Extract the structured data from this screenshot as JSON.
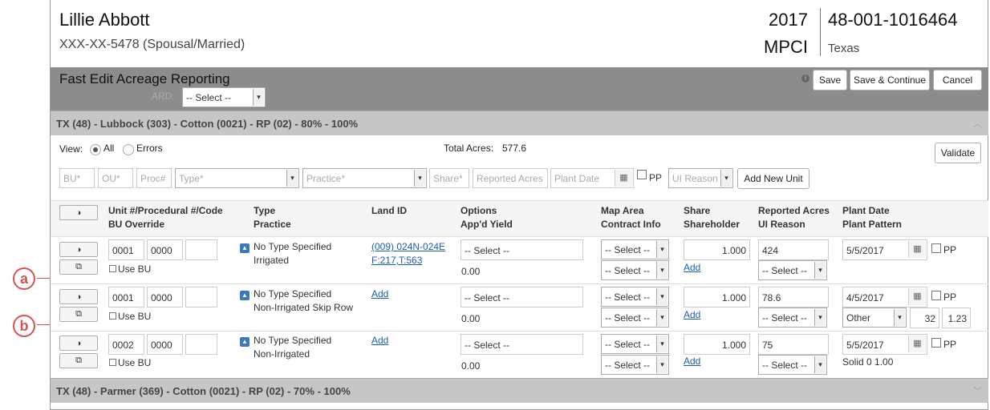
{
  "header": {
    "name": "Lillie Abbott",
    "ssn": "XXX-XX-5478 (Spousal/Married)",
    "year": "2017",
    "insurance": "MPCI",
    "policy": "48-001-1016464",
    "state": "Texas"
  },
  "toolbar": {
    "title": "Fast Edit Acreage Reporting",
    "ard_label": "ARD:",
    "ard_value": "-- Select --",
    "save": "Save",
    "save_continue": "Save & Continue",
    "cancel": "Cancel"
  },
  "section1": {
    "title": "TX (48) - Lubbock (303) - Cotton (0021) - RP (02) - 80% - 100%"
  },
  "section2": {
    "title": "TX (48) - Parmer (369) - Cotton (0021) - RP (02) - 70% - 100%"
  },
  "view": {
    "label": "View:",
    "all": "All",
    "errors": "Errors",
    "total_label": "Total Acres:",
    "total_value": "577.6",
    "validate": "Validate"
  },
  "add_form": {
    "bu": "BU*",
    "ou": "OU*",
    "proc": "Proc#",
    "type": "Type*",
    "practice": "Practice*",
    "share": "Share*",
    "reported_acres": "Reported Acres",
    "plant_date": "Plant Date",
    "pp": "PP",
    "ui_reason": "UI Reason",
    "add_new_unit": "Add New Unit"
  },
  "columns": {
    "unit_1": "Unit #/Procedural #/Code",
    "unit_2": "BU Override",
    "type_1": "Type",
    "type_2": "Practice",
    "land": "Land ID",
    "options_1": "Options",
    "options_2": "App'd Yield",
    "map_1": "Map Area",
    "map_2": "Contract Info",
    "share_1": "Share",
    "share_2": "Shareholder",
    "acres_1": "Reported Acres",
    "acres_2": "UI Reason",
    "plant_1": "Plant Date",
    "plant_2": "Plant Pattern"
  },
  "rows": [
    {
      "unit": "0001",
      "proc": "0000",
      "code": "",
      "use_bu": "Use BU",
      "type": "No Type Specified",
      "practice": "Irrigated",
      "land_1": "(009) 024N-024E",
      "land_2": "F:217,T:563",
      "options": "-- Select --",
      "yield": "0.00",
      "map": "-- Select --",
      "contract": "-- Select --",
      "share": "1.000",
      "share_add": "Add",
      "acres": "424",
      "ui_reason": "-- Select --",
      "plant_date": "5/5/2017",
      "pp": "PP"
    },
    {
      "unit": "0001",
      "proc": "0000",
      "code": "",
      "use_bu": "Use BU",
      "type": "No Type Specified",
      "practice": "Non-Irrigated Skip Row",
      "land_add": "Add",
      "options": "-- Select --",
      "yield": "0.00",
      "map": "-- Select --",
      "contract": "-- Select --",
      "share": "1.000",
      "share_add": "Add",
      "acres": "78.6",
      "ui_reason": "-- Select --",
      "plant_date": "4/5/2017",
      "pp": "PP",
      "pattern": "Other",
      "pattern_a": "32",
      "pattern_b": "1.23"
    },
    {
      "unit": "0002",
      "proc": "0000",
      "code": "",
      "use_bu": "Use BU",
      "type": "No Type Specified",
      "practice": "Non-Irrigated",
      "land_add": "Add",
      "options": "-- Select --",
      "yield": "0.00",
      "map": "-- Select --",
      "contract": "-- Select --",
      "share": "1.000",
      "share_add": "Add",
      "acres": "75",
      "ui_reason": "-- Select --",
      "plant_date": "5/5/2017",
      "pp": "PP",
      "pattern_text": "Solid 0 1.00"
    }
  ],
  "callouts": {
    "a": "a",
    "b": "b"
  },
  "icons": {
    "contrast": "◑",
    "copy": "⧉",
    "type": "▲",
    "calendar": "▦",
    "chevron": "▾",
    "info": "i"
  }
}
